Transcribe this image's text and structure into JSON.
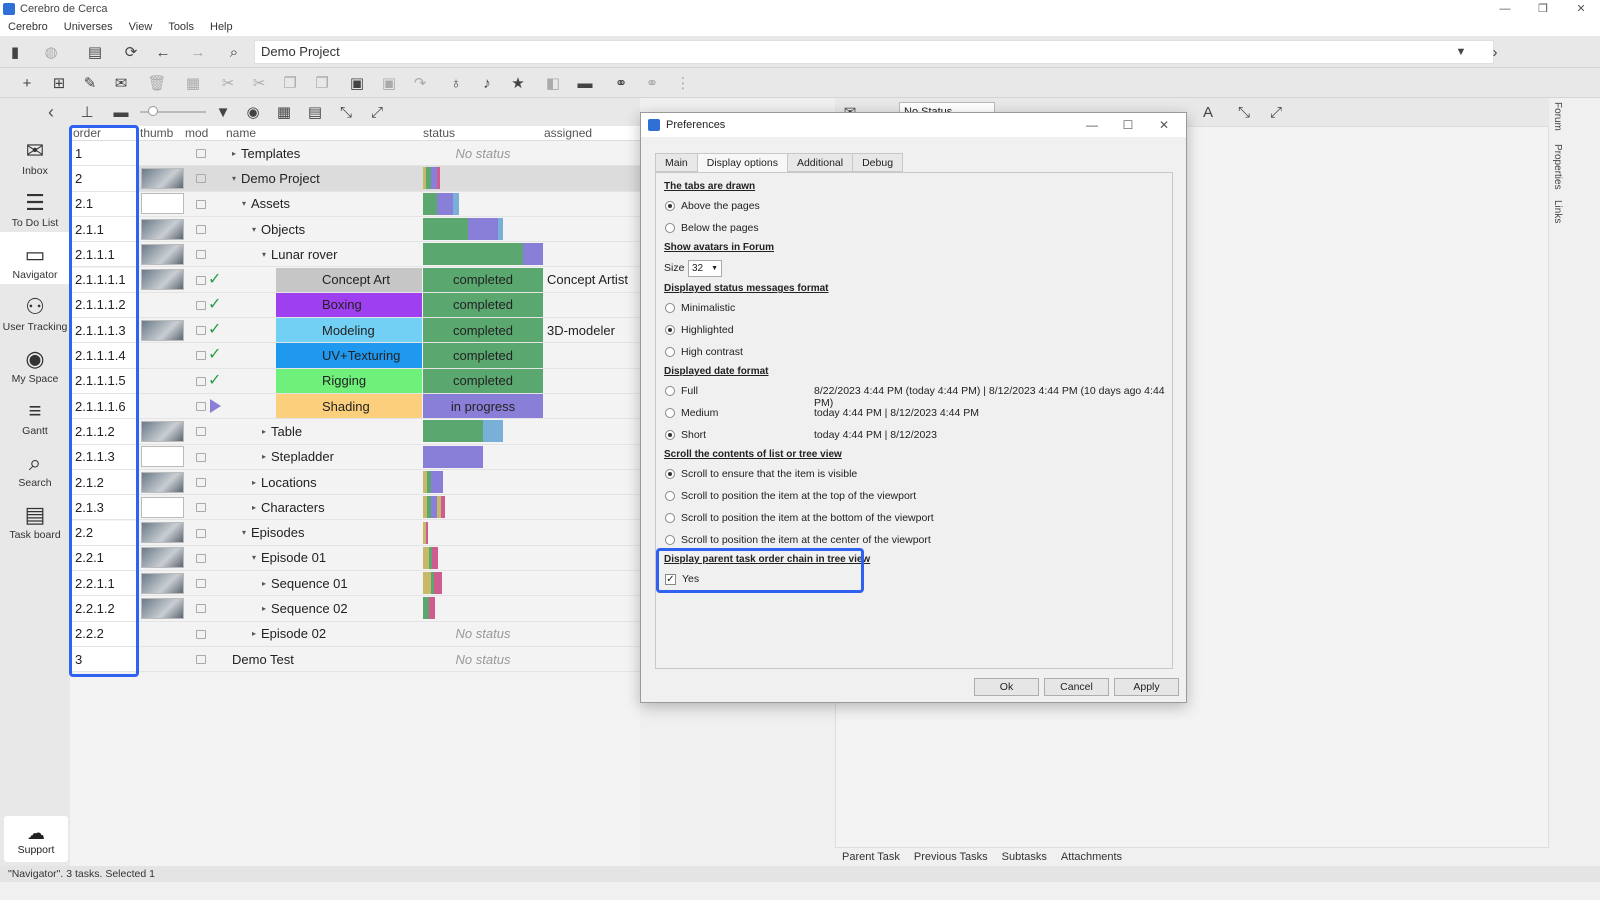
{
  "window": {
    "title": "Cerebro de Cerca",
    "controls": [
      "—",
      "❐",
      "✕"
    ]
  },
  "menu": [
    "Cerebro",
    "Universes",
    "View",
    "Tools",
    "Help"
  ],
  "path": "Demo Project",
  "nav": {
    "items": [
      {
        "label": "Inbox",
        "icon": "envelope-icon"
      },
      {
        "label": "To Do List",
        "icon": "list-icon"
      },
      {
        "label": "Navigator",
        "icon": "folder-icon",
        "active": true
      },
      {
        "label": "User Tracking",
        "icon": "users-icon"
      },
      {
        "label": "My Space",
        "icon": "globe-icon"
      },
      {
        "label": "Gantt",
        "icon": "gantt-icon"
      },
      {
        "label": "Search",
        "icon": "search-icon"
      },
      {
        "label": "Task board",
        "icon": "clipboard-icon"
      }
    ],
    "support": "Support"
  },
  "tree": {
    "columns": [
      "order",
      "thumb",
      "mod",
      "name",
      "status",
      "assigned"
    ],
    "rows": [
      {
        "order": "1",
        "name": "Templates",
        "level": 0,
        "caret": "▸",
        "status": "No status",
        "thumb": "",
        "mod": "box"
      },
      {
        "order": "2",
        "name": "Demo Project",
        "level": 0,
        "caret": "▾",
        "status": "",
        "thumb": "img",
        "mod": "box",
        "selected": true,
        "bars": [
          [
            "#c8b96a",
            3
          ],
          [
            "#5aa86f",
            5
          ],
          [
            "#8a7fd8",
            6
          ],
          [
            "#d05c8f",
            3
          ]
        ]
      },
      {
        "order": "2.1",
        "name": "Assets",
        "level": 1,
        "caret": "▾",
        "status": "",
        "thumb": "w",
        "mod": "box",
        "bars": [
          [
            "#5aa86f",
            14
          ],
          [
            "#8a7fd8",
            16
          ],
          [
            "#7ab0d8",
            6
          ]
        ]
      },
      {
        "order": "2.1.1",
        "name": "Objects",
        "level": 2,
        "caret": "▾",
        "status": "",
        "thumb": "img",
        "mod": "box",
        "bars": [
          [
            "#5aa86f",
            45
          ],
          [
            "#8a7fd8",
            30
          ],
          [
            "#7ab0d8",
            5
          ]
        ]
      },
      {
        "order": "2.1.1.1",
        "name": "Lunar rover",
        "level": 3,
        "caret": "▾",
        "status": "",
        "thumb": "img",
        "mod": "box",
        "bars": [
          [
            "#5aa86f",
            100
          ],
          [
            "#8a7fd8",
            20
          ]
        ]
      },
      {
        "order": "2.1.1.1.1",
        "name": "Concept Art",
        "level": 4,
        "caret": "",
        "status": "completed",
        "statusColor": "#5aa86f",
        "nameBg": "#c6c6c6",
        "thumb": "img",
        "mod": "check",
        "assigned": "Concept Artist"
      },
      {
        "order": "2.1.1.1.2",
        "name": "Boxing",
        "level": 4,
        "caret": "",
        "status": "completed",
        "statusColor": "#5aa86f",
        "nameBg": "#9e3ff0",
        "thumb": "",
        "mod": "check",
        "assigned": ""
      },
      {
        "order": "2.1.1.1.3",
        "name": "Modeling",
        "level": 4,
        "caret": "",
        "status": "completed",
        "statusColor": "#5aa86f",
        "nameBg": "#72d0f5",
        "thumb": "img",
        "mod": "check",
        "assigned": "3D-modeler"
      },
      {
        "order": "2.1.1.1.4",
        "name": "UV+Texturing",
        "level": 4,
        "caret": "",
        "status": "completed",
        "statusColor": "#5aa86f",
        "nameBg": "#1f98f0",
        "thumb": "",
        "mod": "check",
        "assigned": ""
      },
      {
        "order": "2.1.1.1.5",
        "name": "Rigging",
        "level": 4,
        "caret": "",
        "status": "completed",
        "statusColor": "#5aa86f",
        "nameBg": "#6ef07a",
        "thumb": "",
        "mod": "check",
        "assigned": ""
      },
      {
        "order": "2.1.1.1.6",
        "name": "Shading",
        "level": 4,
        "caret": "",
        "status": "in progress",
        "statusColor": "#8a7fd8",
        "nameBg": "#fccf7c",
        "thumb": "",
        "mod": "play",
        "assigned": ""
      },
      {
        "order": "2.1.1.2",
        "name": "Table",
        "level": 3,
        "caret": "▸",
        "status": "",
        "thumb": "img",
        "mod": "box",
        "bars": [
          [
            "#5aa86f",
            60
          ],
          [
            "#7ab0d8",
            20
          ]
        ]
      },
      {
        "order": "2.1.1.3",
        "name": "Stepladder",
        "level": 3,
        "caret": "▸",
        "status": "",
        "thumb": "w",
        "mod": "box",
        "bars": [
          [
            "#8a7fd8",
            60
          ]
        ]
      },
      {
        "order": "2.1.2",
        "name": "Locations",
        "level": 2,
        "caret": "▸",
        "status": "",
        "thumb": "img",
        "mod": "box",
        "bars": [
          [
            "#c8b96a",
            4
          ],
          [
            "#5aa86f",
            4
          ],
          [
            "#8a7fd8",
            12
          ]
        ]
      },
      {
        "order": "2.1.3",
        "name": "Characters",
        "level": 2,
        "caret": "▸",
        "status": "",
        "thumb": "w",
        "mod": "box",
        "bars": [
          [
            "#c8b96a",
            4
          ],
          [
            "#5aa86f",
            4
          ],
          [
            "#8a7fd8",
            6
          ],
          [
            "#c8b96a",
            4
          ],
          [
            "#d05c8f",
            4
          ]
        ]
      },
      {
        "order": "2.2",
        "name": "Episodes",
        "level": 1,
        "caret": "▾",
        "status": "",
        "thumb": "img",
        "mod": "box",
        "bars": [
          [
            "#c8b96a",
            3
          ],
          [
            "#d05c8f",
            2
          ]
        ]
      },
      {
        "order": "2.2.1",
        "name": "Episode 01",
        "level": 2,
        "caret": "▾",
        "status": "",
        "thumb": "img",
        "mod": "box",
        "bars": [
          [
            "#c8b96a",
            6
          ],
          [
            "#5aa86f",
            3
          ],
          [
            "#d05c8f",
            6
          ]
        ]
      },
      {
        "order": "2.2.1.1",
        "name": "Sequence 01",
        "level": 3,
        "caret": "▸",
        "status": "",
        "thumb": "img",
        "mod": "box",
        "bars": [
          [
            "#c8b96a",
            8
          ],
          [
            "#5aa86f",
            3
          ],
          [
            "#d05c8f",
            8
          ]
        ]
      },
      {
        "order": "2.2.1.2",
        "name": "Sequence 02",
        "level": 3,
        "caret": "▸",
        "status": "",
        "thumb": "img",
        "mod": "box",
        "bars": [
          [
            "#5aa86f",
            6
          ],
          [
            "#d05c8f",
            6
          ]
        ]
      },
      {
        "order": "2.2.2",
        "name": "Episode 02",
        "level": 2,
        "caret": "▸",
        "status": "No status",
        "thumb": "",
        "mod": "box"
      },
      {
        "order": "3",
        "name": "Demo Test",
        "level": 0,
        "caret": "",
        "status": "No status",
        "thumb": "",
        "mod": "box"
      }
    ]
  },
  "view_toolbar": {
    "status_select": "No Status"
  },
  "right_panel": {
    "tabs": [
      "Parent Task",
      "Previous Tasks",
      "Subtasks",
      "Attachments"
    ],
    "side_tabs": [
      "Forum",
      "Properties",
      "Links"
    ]
  },
  "statusbar": "\"Navigator\". 3 tasks. Selected 1",
  "dialog": {
    "title": "Preferences",
    "tabs": [
      "Main",
      "Display options",
      "Additional",
      "Debug"
    ],
    "active_tab": "Display options",
    "sections": {
      "tabs_drawn": {
        "title": "The tabs are drawn",
        "options": [
          "Above the pages",
          "Below the pages"
        ],
        "selected": 0
      },
      "avatars": {
        "title": "Show avatars in Forum",
        "size_label": "Size",
        "size_value": "32"
      },
      "status_format": {
        "title": "Displayed status messages format",
        "options": [
          "Minimalistic",
          "Highlighted",
          "High contrast"
        ],
        "selected": 1
      },
      "date_format": {
        "title": "Displayed date format",
        "options": [
          "Full",
          "Medium",
          "Short"
        ],
        "examples": [
          "8/22/2023 4:44 PM (today 4:44 PM) | 8/12/2023 4:44 PM (10 days ago 4:44 PM)",
          "today 4:44 PM | 8/12/2023 4:44 PM",
          "today 4:44 PM | 8/12/2023"
        ],
        "selected": 2
      },
      "scroll": {
        "title": "Scroll the contents of list or tree view",
        "options": [
          "Scroll to ensure that the item is visible",
          "Scroll to position the item at the top of the viewport",
          "Scroll to position the item at the bottom of the viewport",
          "Scroll to position the item at the center of the viewport"
        ],
        "selected": 0
      },
      "chain": {
        "title": "Display parent task order chain in tree view",
        "checkbox": "Yes",
        "checked": true
      }
    },
    "buttons": {
      "ok": "Ok",
      "cancel": "Cancel",
      "apply": "Apply"
    }
  },
  "colors": {
    "highlight": "#2f62f0",
    "completed": "#5aa86f",
    "in_progress": "#8a7fd8"
  }
}
